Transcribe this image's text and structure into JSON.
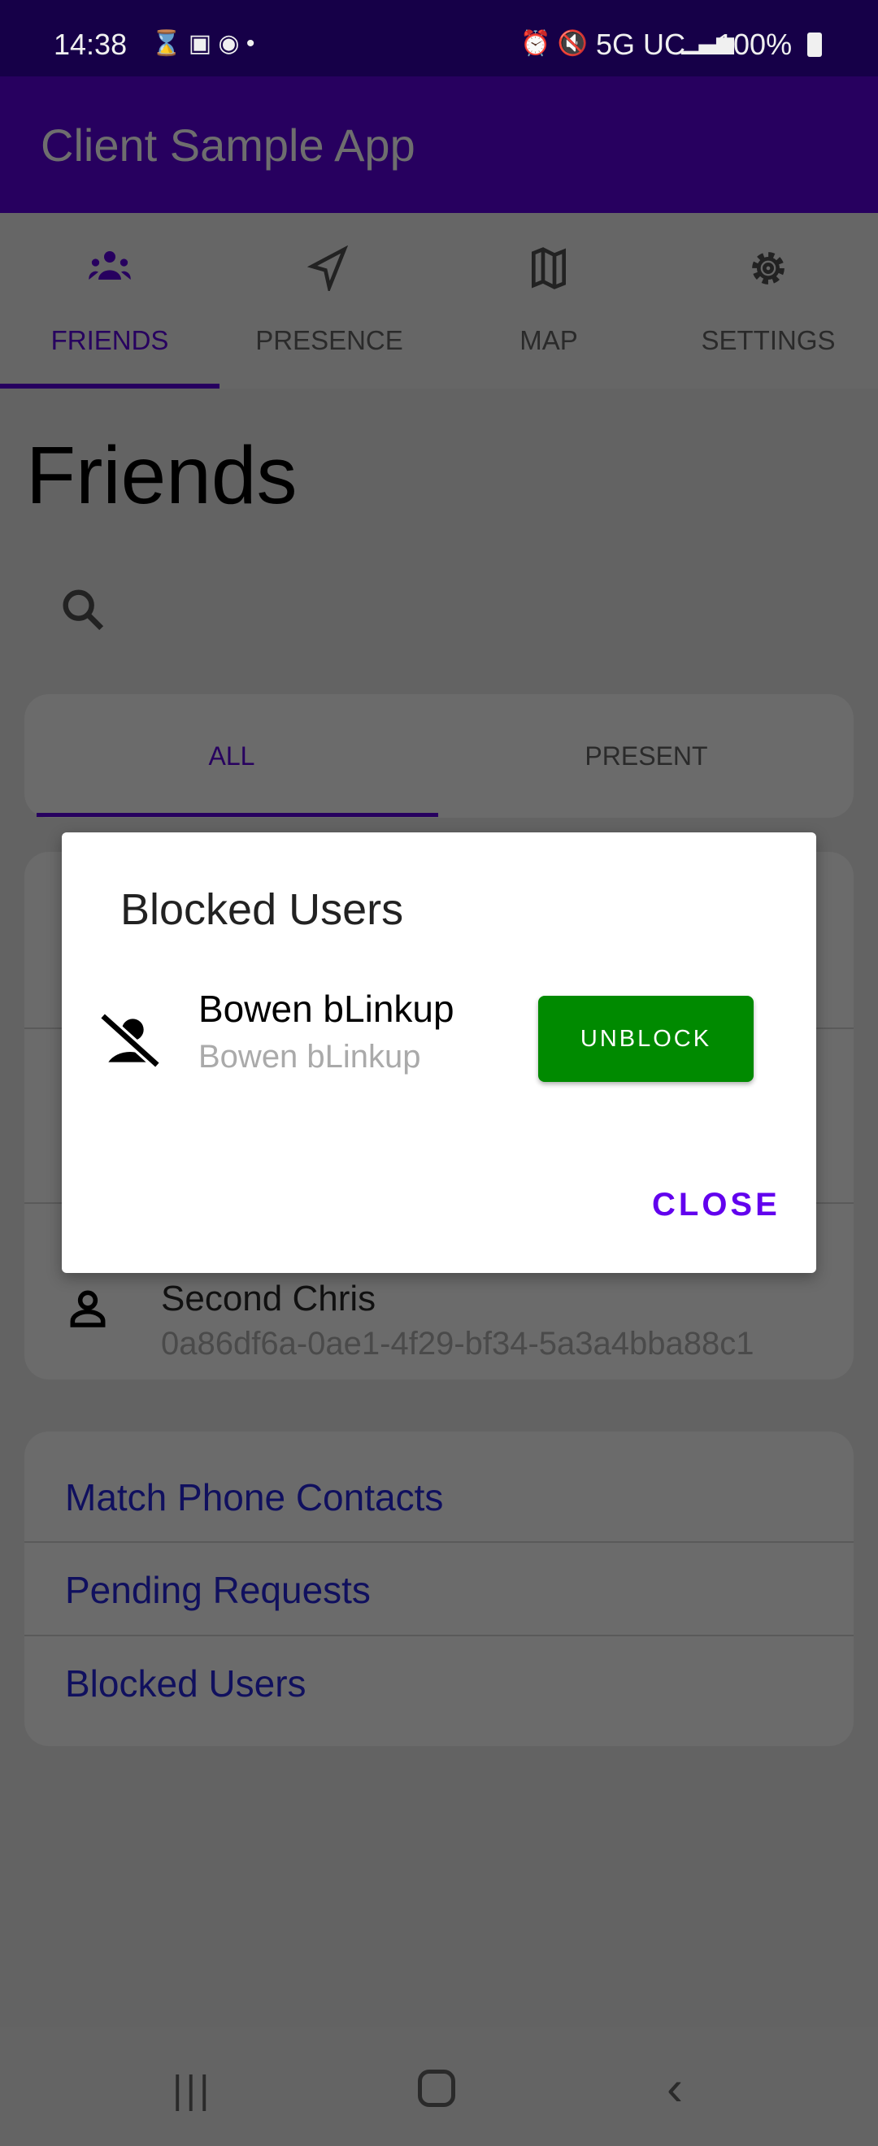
{
  "status": {
    "time": "14:38",
    "network": "5G UC",
    "battery": "100%"
  },
  "app": {
    "title": "Client Sample App"
  },
  "tabs": [
    {
      "label": "FRIENDS"
    },
    {
      "label": "PRESENCE"
    },
    {
      "label": "MAP"
    },
    {
      "label": "SETTINGS"
    }
  ],
  "page": {
    "heading": "Friends"
  },
  "filter_tabs": [
    {
      "label": "ALL"
    },
    {
      "label": "PRESENT"
    }
  ],
  "friends": [
    {
      "name": "Second Chris",
      "id": "0a86df6a-0ae1-4f29-bf34-5a3a4bba88c1"
    }
  ],
  "links": [
    {
      "label": "Match Phone Contacts"
    },
    {
      "label": "Pending Requests"
    },
    {
      "label": "Blocked Users"
    }
  ],
  "dialog": {
    "title": "Blocked Users",
    "users": [
      {
        "name": "Bowen bLinkup",
        "subtitle": "Bowen bLinkup",
        "action": "UNBLOCK"
      }
    ],
    "close": "CLOSE"
  },
  "colors": {
    "primary": "#6200ee",
    "primary_dark": "#3700b3",
    "unblock": "#008a00"
  }
}
